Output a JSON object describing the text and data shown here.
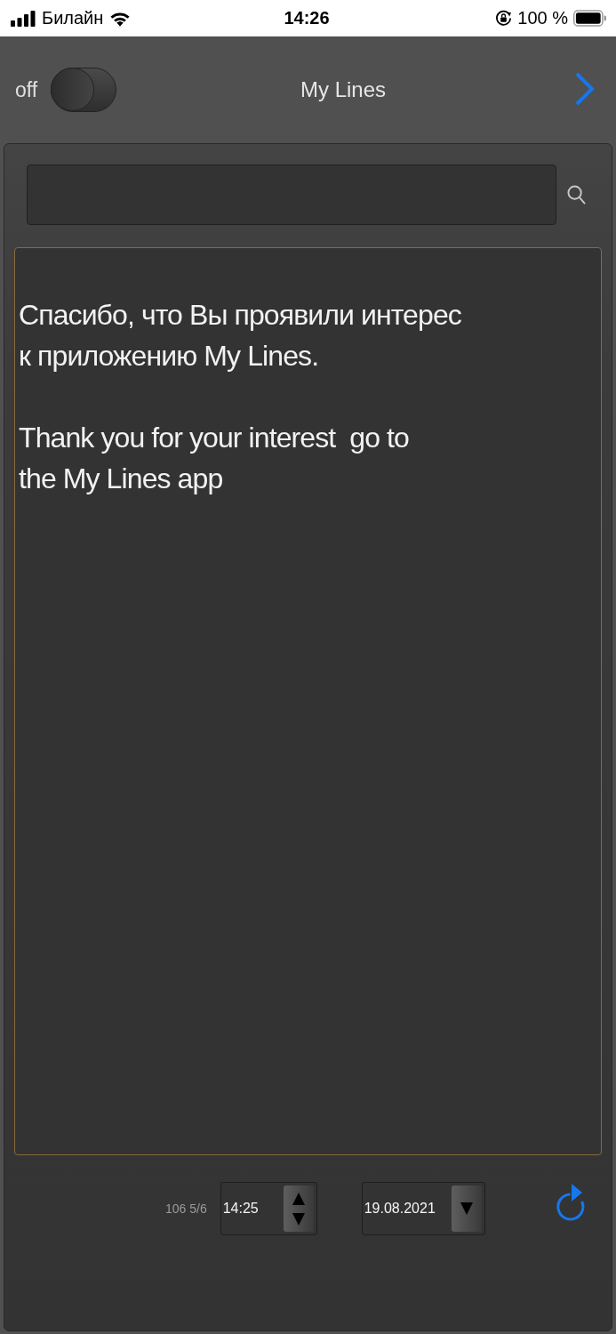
{
  "status_bar": {
    "carrier": "Билайн",
    "time": "14:26",
    "battery": "100 %"
  },
  "header": {
    "toggle": {
      "label": "off",
      "on": false
    },
    "title": "My Lines"
  },
  "message": "Спасибо, что Вы проявили интерес\nк приложению My Lines.\n\nThank you for your interest  go to\nthe My Lines app",
  "footer": {
    "counter": "106 5/6",
    "time_field": {
      "value": "14:25"
    },
    "date_field": {
      "value": "19.08.2021"
    }
  }
}
